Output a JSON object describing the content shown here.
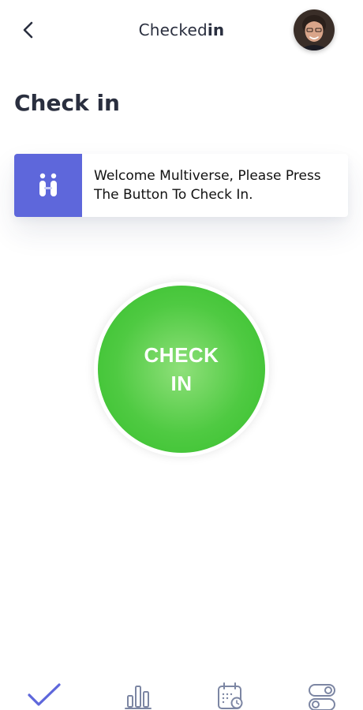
{
  "header": {
    "title_regular": "Checked",
    "title_bold": "in"
  },
  "page": {
    "title": "Check in"
  },
  "welcome": {
    "message": "Welcome Multiverse, Please Press The Button To Check In."
  },
  "checkin_button": {
    "label_line1": "CHECK",
    "label_line2": "IN"
  },
  "nav": [
    {
      "icon": "checkmark-icon",
      "active": true
    },
    {
      "icon": "bar-chart-icon",
      "active": false
    },
    {
      "icon": "calendar-clock-icon",
      "active": false
    },
    {
      "icon": "toggle-settings-icon",
      "active": false
    }
  ],
  "colors": {
    "accent": "#5e67db",
    "check_green": "#4fca42",
    "text_dark": "#2a2f3f",
    "nav_inactive": "#7c86a3"
  }
}
